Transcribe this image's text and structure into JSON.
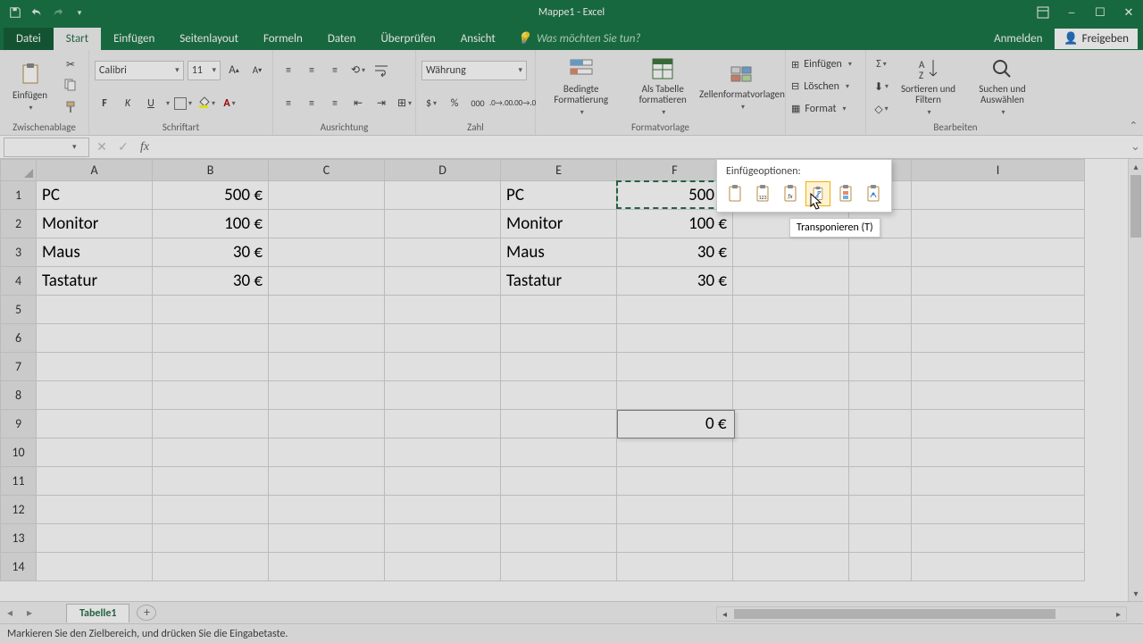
{
  "window": {
    "title": "Mappe1 - Excel"
  },
  "qat": {
    "save": "save-icon",
    "undo": "undo-icon",
    "redo": "redo-icon"
  },
  "tabs": {
    "file": "Datei",
    "items": [
      "Start",
      "Einfügen",
      "Seitenlayout",
      "Formeln",
      "Daten",
      "Überprüfen",
      "Ansicht"
    ],
    "active": "Start",
    "tellme_placeholder": "Was möchten Sie tun?",
    "signin": "Anmelden",
    "share": "Freigeben"
  },
  "ribbon": {
    "clipboard": {
      "label": "Zwischenablage",
      "paste": "Einfügen"
    },
    "font": {
      "label": "Schriftart",
      "name": "Calibri",
      "size": "11",
      "bold": "F",
      "italic": "K",
      "underline": "U"
    },
    "alignment": {
      "label": "Ausrichtung"
    },
    "number": {
      "label": "Zahl",
      "format": "Währung"
    },
    "styles": {
      "label": "Formatvorlage",
      "cond": "Bedingte Formatierung",
      "table": "Als Tabelle formatieren",
      "cell": "Zellenformatvorlagen"
    },
    "cells": {
      "insert": "Einfügen",
      "delete": "Löschen",
      "format": "Format"
    },
    "editing": {
      "label": "Bearbeiten",
      "sort": "Sortieren und Filtern",
      "find": "Suchen und Auswählen"
    }
  },
  "formulabar": {
    "name": "",
    "formula": ""
  },
  "columns": [
    "A",
    "B",
    "C",
    "D",
    "E",
    "F",
    "G",
    "H",
    "I"
  ],
  "rows_shown": 14,
  "cells": {
    "A1": "PC",
    "B1": "500 €",
    "E1": "PC",
    "F1": "500 €",
    "A2": "Monitor",
    "B2": "100 €",
    "E2": "Monitor",
    "F2": "100 €",
    "A3": "Maus",
    "B3": "30 €",
    "E3": "Maus",
    "F3": "30 €",
    "A4": "Tastatur",
    "B4": "30 €",
    "E4": "Tastatur",
    "F4": "30 €"
  },
  "marquee_cell": "F1",
  "edit_cell": {
    "ref": "F9",
    "value": "0 €"
  },
  "paste_options": {
    "title": "Einfügeoptionen:",
    "items": [
      {
        "id": "paste",
        "name": "paste-icon"
      },
      {
        "id": "values",
        "name": "paste-values-123-icon",
        "badge": "123"
      },
      {
        "id": "formulas",
        "name": "paste-formulas-fx-icon",
        "badge": "fx"
      },
      {
        "id": "transpose",
        "name": "paste-transpose-icon",
        "selected": true
      },
      {
        "id": "formatting",
        "name": "paste-formatting-icon"
      },
      {
        "id": "link",
        "name": "paste-link-icon"
      }
    ],
    "tooltip": "Transponieren (T)"
  },
  "sheet_tabs": {
    "active": "Tabelle1"
  },
  "status": "Markieren Sie den Zielbereich, und drücken Sie die Eingabetaste."
}
